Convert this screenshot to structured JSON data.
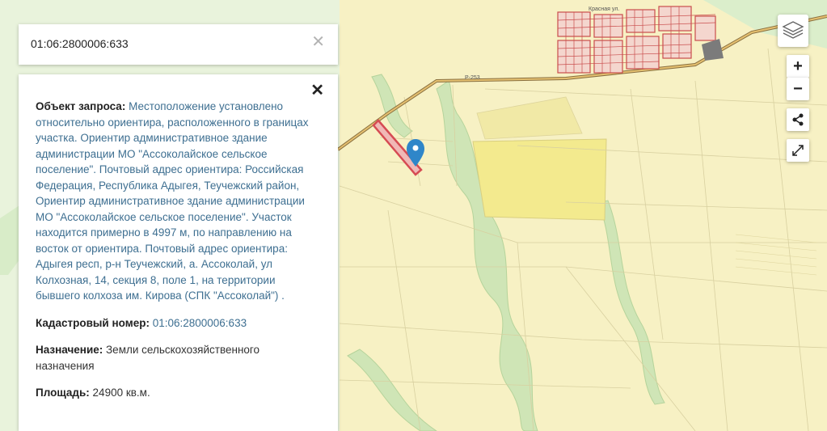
{
  "search": {
    "value": "01:06:2800006:633"
  },
  "map": {
    "road_label": "Р-253",
    "street_label": "Красная ул."
  },
  "info": {
    "object_label": "Объект запроса:",
    "object_value": "Местоположение установлено относительно ориентира, расположенного в границах участка. Ориентир административное здание администрации МО \"Ассоколайское сельское поселение\". Почтовый адрес ориентира: Российская Федерация, Республика Адыгея, Теучежский район, Ориентир административное здание администрации МО \"Ассоколайское сельское поселение\". Участок находится примерно в 4997 м, по направлению на восток от ориентира. Почтовый адрес ориентира: Адыгея респ, р-н Теучежский, а. Ассоколай, ул Колхозная, 14, секция 8, поле 1, на территории бывшего колхоза им. Кирова (СПК \"Ассоколай\") .",
    "cadastral_label": "Кадастровый номер:",
    "cadastral_value": "01:06:2800006:633",
    "purpose_label": "Назначение:",
    "purpose_value": "Земли сельскохозяйственного назначения",
    "area_label": "Площадь:",
    "area_value": "24900 кв.м."
  },
  "controls": {
    "zoom_in": "+",
    "zoom_out": "−"
  },
  "icons": [
    "layers-icon",
    "share-icon",
    "fullscreen-icon",
    "map-marker-icon",
    "close-icon"
  ],
  "colors": {
    "map_background": "#f7f1c4",
    "parcel_highlight": "#d64b53",
    "marker": "#2f86c9",
    "link": "#3e6f91",
    "river": "#bcd9a8"
  }
}
